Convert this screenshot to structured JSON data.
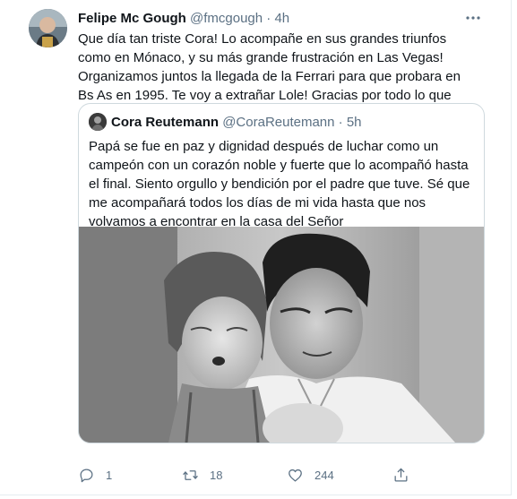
{
  "tweet": {
    "display_name": "Felipe Mc Gough",
    "handle": "@fmcgough",
    "separator": "·",
    "time": "4h",
    "text": "Que día tan triste Cora! Lo acompañe en sus grandes triunfos como en Mónaco, y su más grande frustración en Las Vegas! Organizamos juntos la llegada de la Ferrari para que probara en Bs As en 1995. Te voy a extrañar Lole! Gracias por todo lo que nos diste! QDEP",
    "icons": {
      "more": "more-horizontal-icon",
      "folded_hands": "folded-hands-emoji",
      "flag": "argentina-flag-emoji"
    }
  },
  "quoted": {
    "display_name": "Cora Reutemann",
    "handle": "@CoraReutemann",
    "separator": "·",
    "time": "5h",
    "text": "Papá se fue en paz y dignidad después de luchar como un campeón con un corazón noble y fuerte que lo acompañó hasta el final. Siento orgullo y bendición por el padre que tuve. Sé que me acompañará todos los días de mi vida hasta que nos volvamos a encontrar en la casa del Señor",
    "photo": "black-and-white-photo-man-and-child"
  },
  "actions": {
    "reply": {
      "icon": "reply-icon",
      "count": "1"
    },
    "retweet": {
      "icon": "retweet-icon",
      "count": "18"
    },
    "like": {
      "icon": "heart-icon",
      "count": "244"
    },
    "share": {
      "icon": "share-icon"
    }
  },
  "colors": {
    "text": "#0f1419",
    "secondary": "#5b7083",
    "border": "#cfd9de"
  }
}
